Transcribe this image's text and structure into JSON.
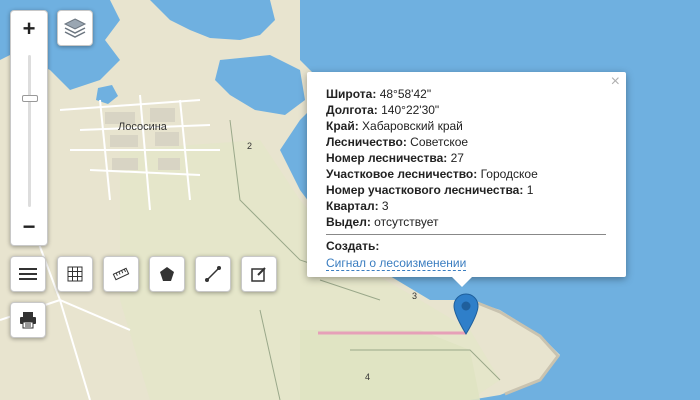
{
  "map": {
    "place_label": "Лососина",
    "quarter_labels": [
      "2",
      "3",
      "4"
    ]
  },
  "controls": {
    "zoom_in": "+",
    "zoom_out": "−",
    "zoom_level_fraction": 0.28,
    "icons": [
      "layers-icon",
      "menu-icon",
      "grid-icon",
      "ruler-icon",
      "polygon-icon",
      "line-icon",
      "edit-icon",
      "print-icon"
    ]
  },
  "popup": {
    "close": "×",
    "rows": [
      {
        "label": "Широта:",
        "value": "48°58'42\""
      },
      {
        "label": "Долгота:",
        "value": "140°22'30\""
      },
      {
        "label": "Край:",
        "value": "Хабаровский край"
      },
      {
        "label": "Лесничество:",
        "value": "Советское"
      },
      {
        "label": "Номер лесничества:",
        "value": "27"
      },
      {
        "label": "Участковое лесничество:",
        "value": "Городское"
      },
      {
        "label": "Номер участкового лесничества:",
        "value": "1"
      },
      {
        "label": "Квартал:",
        "value": "3"
      },
      {
        "label": "Выдел:",
        "value": "отсутствует"
      }
    ],
    "create_label": "Создать:",
    "link": "Сигнал о лесоизменении"
  },
  "colors": {
    "water": "#6fb0e0",
    "land": "#e8e4cf",
    "marker": "#2f7fc9",
    "boundary": "#e6a0b8"
  }
}
